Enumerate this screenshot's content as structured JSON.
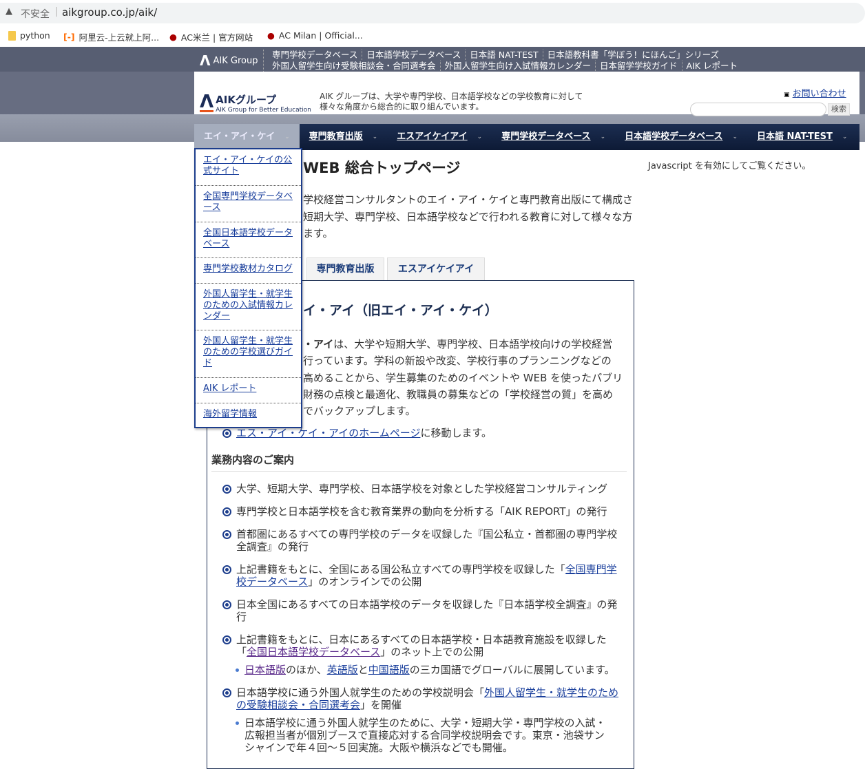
{
  "browser": {
    "security": "不安全",
    "url": "aikgroup.co.jp/aik/",
    "bookmarks": [
      "python",
      "阿里云-上云就上阿...",
      "AC米兰 | 官方网站",
      "AC Milan | Official..."
    ]
  },
  "global": {
    "logo": "AIK Group",
    "links_row1": [
      "専門学校データベース",
      "日本語学校データベース",
      "日本語 NAT-TEST",
      "日本語教科書「学ぼう！にほんご」シリーズ"
    ],
    "links_row2": [
      "外国人留学生向け受験相談会・合同選考会",
      "外国人留学生向け入試情報カレンダー",
      "日本留学学校ガイド",
      "AIK レポート"
    ]
  },
  "header": {
    "logo_title": "AIKグループ",
    "logo_sub": "AIK Group for Better Education",
    "tagline1": "AIK グループは、大学や専門学校、日本語学校などの学校教育に対して",
    "tagline2": "様々な角度から総合的に取り組んでいます。",
    "contact": "お問い合わせ",
    "search_button": "検索",
    "search_value": ""
  },
  "nav": [
    {
      "label": "エイ・アイ・ケイ",
      "active": true
    },
    {
      "label": "専門教育出版"
    },
    {
      "label": "エスアイケイアイ"
    },
    {
      "label": "専門学校データベース"
    },
    {
      "label": "日本語学校データベース"
    },
    {
      "label": "日本語 NAT-TEST"
    }
  ],
  "dropdown": [
    "エイ・アイ・ケイの公式サイト",
    "全国専門学校データベース",
    "全国日本語学校データベース",
    "専門学校教材カタログ",
    "外国人留学生・就学生のための入試情報カレンダー",
    "外国人留学生・就学生のための学校選びガイド",
    "AIK レポート",
    "海外留学情報"
  ],
  "main": {
    "title": "WEB 総合トップページ",
    "js_note": "Javascript を有効にしてご覧ください。",
    "intro": [
      "学校経営コンサルタントのエイ・アイ・ケイと専門教育出版にて構成さ",
      "短期大学、専門学校、日本語学校などで行われる教育に対して様々な方",
      "ます。"
    ],
    "tabs": [
      "専門教育出版",
      "エスアイケイアイ"
    ],
    "heading": "イ・アイ（旧エイ・アイ・ケイ）",
    "para_bold": "・アイ",
    "para": [
      "は、大学や短期大学、専門学校、日本語学校向けの学校経営",
      "行っています。学科の新設や改変、学校行事のプランニングなどの",
      "高めることから、学生募集のためのイベントや WEB を使ったパブリ",
      "財務の点検と最適化、教職員の募集などの「学校経営の質」を高め",
      "でバックアップします。"
    ],
    "home_link": "エス・アイ・ケイ・アイのホームページ",
    "home_suffix": "に移動します。",
    "section": "業務内容のご案内",
    "items": [
      {
        "text": "大学、短期大学、専門学校、日本語学校を対象とした学校経営コンサルティング"
      },
      {
        "text": "専門学校と日本語学校を含む教育業界の動向を分析する「AIK REPORT」の発行"
      },
      {
        "text": "首都圏にあるすべての専門学校のデータを収録した『国公私立・首都圏の専門学校全調査』の発行"
      },
      {
        "pre": "上記書籍をもとに、全国にある国公私立すべての専門学校を収録した「",
        "link": "全国専門学校データベース",
        "post": "」のオンラインでの公開"
      },
      {
        "text": "日本全国にあるすべての日本語学校のデータを収録した『日本語学校全調査』の発行"
      },
      {
        "pre": "上記書籍をもとに、日本にあるすべての日本語学校・日本語教育施設を収録した「",
        "link": "全国日本語学校データベース",
        "post": "」のネット上での公開"
      },
      {
        "pre": "日本語学校に通う外国人就学生のための学校説明会「",
        "link": "外国人留学生・就学生のための受験相談会・合同選考会",
        "post": "」を開催"
      }
    ],
    "sub1": {
      "l1": "日本語版",
      "t1": "のほか、",
      "l2": "英語版",
      "t2": "と",
      "l3": "中国語版",
      "t3": "の三カ国語でグローバルに展開しています。"
    },
    "sub2": "日本語学校に通う外国人就学生のために、大学・短期大学・専門学校の入試・広報担当者が個別ブースで直接応対する合同学校説明会です。東京・池袋サンシャインで年４回～５回実施。大阪や横浜などでも開催。"
  }
}
